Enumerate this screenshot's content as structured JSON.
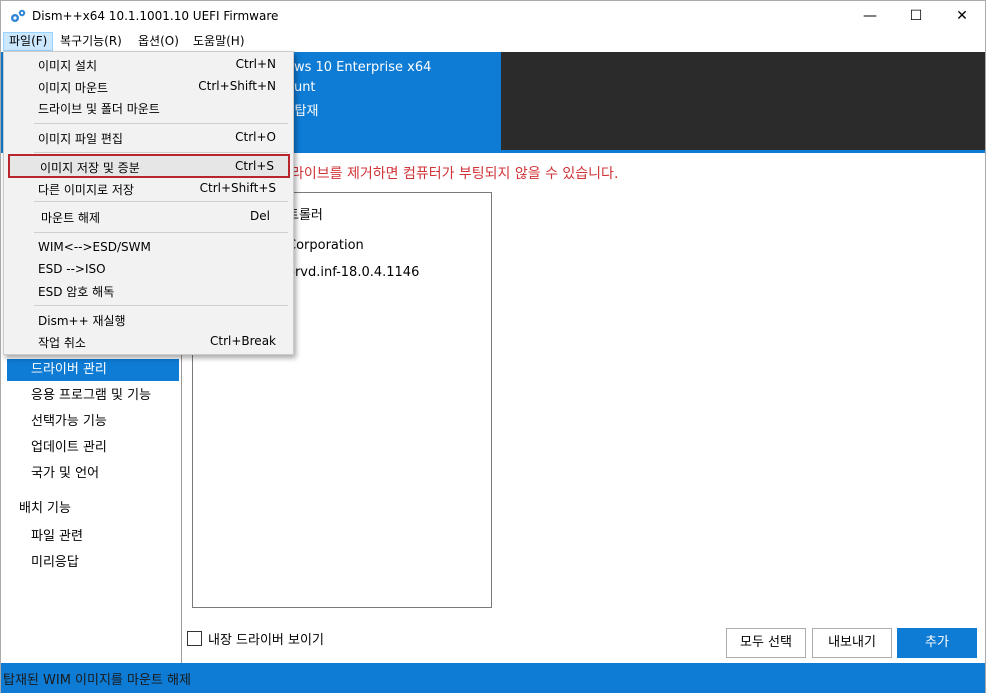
{
  "window": {
    "title": "Dism++x64 10.1.1001.10 UEFI Firmware",
    "minimize": "—",
    "maximize": "☐",
    "close": "✕"
  },
  "menubar": {
    "file": "파일(F)",
    "recovery": "복구기능(R)",
    "options": "옵션(O)",
    "help": "도움말(H)"
  },
  "header": {
    "line1": "ows 10 Enterprise x64",
    "line2": "ount",
    "line3": "| 탑재"
  },
  "warning": "라이브를 제거하면 컴퓨터가 부팅되지 않을 수 있습니다.",
  "list": {
    "item_title": "트롤러",
    "item_vendor": "Corporation",
    "item_inf": "orvd.inf-18.0.4.1146"
  },
  "sidebar": {
    "items": [
      {
        "label": "드라이버 관리"
      },
      {
        "label": "응용 프로그램 및 기능"
      },
      {
        "label": "선택가능 기능"
      },
      {
        "label": "업데이트 관리"
      },
      {
        "label": "국가 및 언어"
      }
    ],
    "group_deploy": "배치 기능",
    "deploy_items": [
      {
        "label": "파일 관련"
      },
      {
        "label": "미리응답"
      }
    ]
  },
  "checkbox_label": "내장 드라이버 보이기",
  "buttons": {
    "select_all": "모두 선택",
    "export": "내보내기",
    "add": "추가"
  },
  "status": "탑재된 WIM 이미지를 마운트 해제",
  "file_menu": {
    "items": [
      {
        "label": "이미지 설치",
        "shortcut": "Ctrl+N"
      },
      {
        "label": "이미지 마운트",
        "shortcut": "Ctrl+Shift+N"
      },
      {
        "label": "드라이브 및 폴더 마운트",
        "shortcut": ""
      },
      {
        "label": "이미지 파일 편집",
        "shortcut": "Ctrl+O"
      },
      {
        "label": "이미지 저장 및 증분",
        "shortcut": "Ctrl+S"
      },
      {
        "label": "다른 이미지로 저장",
        "shortcut": "Ctrl+Shift+S"
      },
      {
        "label": "마운트 해제",
        "shortcut": "Del"
      },
      {
        "label": "WIM<-->ESD/SWM",
        "shortcut": ""
      },
      {
        "label": "ESD -->ISO",
        "shortcut": ""
      },
      {
        "label": "ESD 암호 해독",
        "shortcut": ""
      },
      {
        "label": "Dism++ 재실행",
        "shortcut": ""
      },
      {
        "label": "작업 취소",
        "shortcut": "Ctrl+Break"
      }
    ]
  },
  "colors": {
    "accent": "#0e7bd4",
    "warning": "#d13438",
    "highlight_border": "#b8262b",
    "header_dark": "#2b2b2b"
  }
}
